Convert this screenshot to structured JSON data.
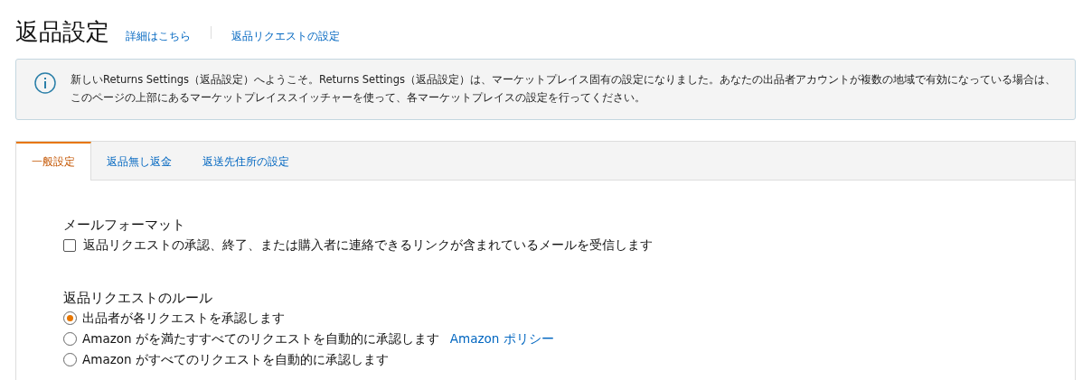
{
  "header": {
    "title": "返品設定",
    "links": [
      "詳細はこちら",
      "返品リクエストの設定"
    ]
  },
  "notice": {
    "text": "新しいReturns Settings（返品設定）へようこそ。Returns Settings（返品設定）は、マーケットプレイス固有の設定になりました。あなたの出品者アカウントが複数の地域で有効になっている場合は、このページの上部にあるマーケットプレイススイッチャーを使って、各マーケットプレイスの設定を行ってください。"
  },
  "tabs": [
    {
      "label": "一般設定",
      "selected": true
    },
    {
      "label": "返品無し返金",
      "selected": false
    },
    {
      "label": "返送先住所の設定",
      "selected": false
    }
  ],
  "email_format": {
    "heading": "メールフォーマット",
    "option": {
      "label": "返品リクエストの承認、終了、または購入者に連絡できるリンクが含まれているメールを受信します",
      "checked": false
    }
  },
  "request_rules": {
    "heading": "返品リクエストのルール",
    "options": [
      {
        "label": "出品者が各リクエストを承認します",
        "selected": true
      },
      {
        "label": "Amazon がを満たすすべてのリクエストを自動的に承認します",
        "link": "Amazon ポリシー",
        "selected": false
      },
      {
        "label": "Amazon がすべてのリクエストを自動的に承認します",
        "selected": false
      }
    ]
  }
}
